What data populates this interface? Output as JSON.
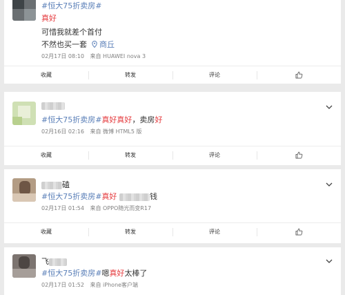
{
  "posts": [
    {
      "topic": "#恒大75折卖房#",
      "lines": [
        {
          "text": "真好",
          "red": true
        },
        {
          "text": "可惜我就差个首付"
        },
        {
          "text": "不然也买一套"
        }
      ],
      "location": "商丘",
      "time": "02月17日 08:10",
      "source": "来自 HUAWEI nova 3",
      "actions": [
        "收藏",
        "转发",
        "评论"
      ]
    },
    {
      "topic": "#恒大75折卖房#",
      "body_red": "真好真好",
      "body_text": "，卖房",
      "body_tail": "好",
      "time": "02月16日 02:16",
      "source": "来自 微博 HTML5 版",
      "actions": [
        "收藏",
        "转发",
        "评论"
      ]
    },
    {
      "name_suffix": "磕",
      "topic": "#恒大75折卖房#",
      "body_red": "真好",
      "body_text": "钱",
      "time": "02月17日 01:54",
      "source": "来自 OPPO随光而变R17",
      "actions": [
        "收藏",
        "转发",
        "评论"
      ]
    },
    {
      "name_prefix": "飞",
      "topic": "#恒大75折卖房#",
      "body_prefix": "嗯",
      "body_red": "真好",
      "body_text": "太棒了",
      "time": "02月17日 01:52",
      "source": "来自 iPhone客户端"
    }
  ],
  "icons": {
    "like": "thumbs-up-icon",
    "expand": "chevron-down-icon",
    "location": "location-pin-icon"
  },
  "colors": {
    "topic": "#5a7fb8",
    "highlight": "#e4393c",
    "meta": "#808080"
  }
}
